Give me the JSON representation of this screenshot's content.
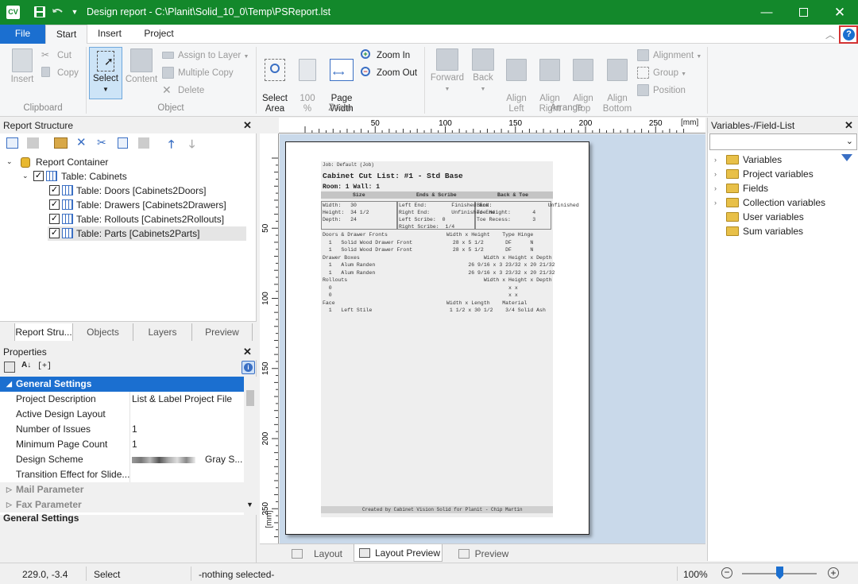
{
  "app": {
    "logo": "CV",
    "title": "Design report - C:\\Planit\\Solid_10_0\\Temp\\PSReport.lst"
  },
  "tabs": {
    "file": "File",
    "items": [
      "Start",
      "Insert",
      "Project"
    ],
    "active": "Start"
  },
  "ribbon": {
    "clipboard": {
      "insert": "Insert",
      "cut": "Cut",
      "copy": "Copy",
      "label": "Clipboard"
    },
    "object": {
      "select": "Select",
      "content": "Content",
      "assign": "Assign to Layer",
      "multiple": "Multiple Copy",
      "delete": "Delete",
      "label": "Object"
    },
    "zoom": {
      "select_area": "Select\nArea",
      "hundred": "100\n%",
      "page_width": "Page\nWidth",
      "zoom_in": "Zoom In",
      "zoom_out": "Zoom Out",
      "label": "Zoom"
    },
    "arrange": {
      "forward": "Forward",
      "back": "Back",
      "align_left": "Align\nLeft",
      "align_right": "Align\nRight",
      "align_top": "Align\nTop",
      "align_bottom": "Align\nBottom",
      "alignment": "Alignment",
      "group": "Group",
      "position": "Position",
      "label": "Arrange"
    }
  },
  "report_structure": {
    "title": "Report Structure",
    "root": "Report Container",
    "table": "Table: Cabinets",
    "children": [
      "Table: Doors [Cabinets2Doors]",
      "Table: Drawers [Cabinets2Drawers]",
      "Table: Rollouts [Cabinets2Rollouts]",
      "Table: Parts [Cabinets2Parts]"
    ],
    "bottom_tabs": [
      "Report Stru...",
      "Objects",
      "Layers",
      "Preview"
    ]
  },
  "properties": {
    "title": "Properties",
    "sort_label": "[+]",
    "section": "General Settings",
    "rows": [
      {
        "k": "Project Description",
        "v": "List & Label Project File"
      },
      {
        "k": "Active Design Layout",
        "v": ""
      },
      {
        "k": "Number of Issues",
        "v": "1"
      },
      {
        "k": "Minimum Page Count",
        "v": "1"
      },
      {
        "k": "Design Scheme",
        "v": "Gray S..."
      },
      {
        "k": "Transition Effect for Slide...",
        "v": ""
      }
    ],
    "collapsed": [
      "Mail Parameter",
      "Fax Parameter"
    ],
    "footer": "General Settings"
  },
  "ruler": {
    "unit": "[mm]",
    "top_ticks": [
      "50",
      "100",
      "150",
      "200",
      "250"
    ],
    "left_ticks": [
      "50",
      "100",
      "150",
      "200",
      "250"
    ]
  },
  "report": {
    "header_small": "Job: Default (Job)",
    "title": "Cabinet Cut List: #1 - Std Base",
    "room": "Room: 1 Wall: 1",
    "cols": [
      "Size",
      "Ends & Scribe",
      "Back & Toe"
    ],
    "size_rows": [
      "Width:   30",
      "Height:  34 1/2",
      "Depth:   24"
    ],
    "ends_rows": [
      "Left End:        Finished End",
      "Right End:       Unfinished End",
      "Left Scribe:  0",
      "Right Scribe:  1/4"
    ],
    "back_rows": [
      "Back:                  Unfinished",
      "Toe Height:       4",
      "Toe Recess:       3"
    ],
    "sections": [
      "Doors & Drawer Fronts                   Width x Height    Type Hinge",
      "  1   Solid Wood Drawer Front             28 x 5 1/2       DF      N",
      "  1   Solid Wood Drawer Front             28 x 5 1/2       DF      N",
      "Drawer Boxes                                        Width x Height x Depth",
      "  1   Alum Randen                              26 9/16 x 3 23/32 x 20 21/32",
      "  1   Alum Randen                              26 9/16 x 3 23/32 x 20 21/32",
      "Rollouts                                            Width x Height x Depth",
      "  0                                                         x x",
      "  0                                                         x x",
      "Face                                    Width x Length    Material",
      "  1   Left Stile                         1 1/2 x 30 1/2    3/4 Solid Ash"
    ],
    "footer": "Created by Cabinet Vision Solid for Planit - Chip Martin"
  },
  "view_tabs": [
    "Layout",
    "Layout Preview",
    "Preview"
  ],
  "variables": {
    "title": "Variables-/Field-List",
    "items": [
      "Variables",
      "Project variables",
      "Fields",
      "Collection variables",
      "User variables",
      "Sum variables"
    ]
  },
  "status": {
    "coords": "229.0, -3.4",
    "mode": "Select",
    "selection": "-nothing selected-",
    "zoom": "100%",
    "zoom_level": 0.5
  },
  "colors": {
    "accent": "#13882b",
    "file_tab": "#1b6fd0",
    "highlight": "#d33333"
  }
}
